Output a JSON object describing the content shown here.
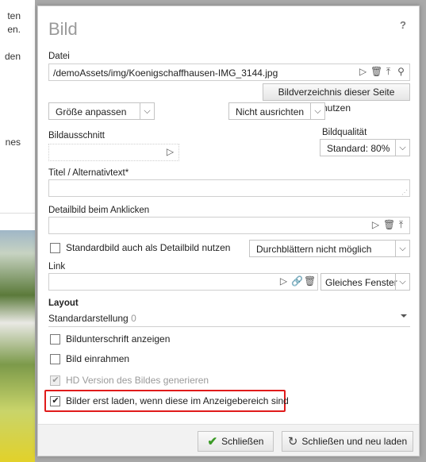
{
  "background": {
    "text_lines": [
      "ten",
      "en.",
      "den",
      "nes"
    ]
  },
  "dialog": {
    "title": "Bild",
    "help": "?",
    "datei": {
      "label": "Datei",
      "value": "/demoAssets/img/Koenigschaffhausen-IMG_3144.jpg",
      "button": "Bildverzeichnis dieser Seite nutzen"
    },
    "groesse": {
      "value": "Größe anpassen"
    },
    "ausrichten": {
      "value": "Nicht ausrichten"
    },
    "bildausschnitt": {
      "label": "Bildausschnitt"
    },
    "bildqualitaet": {
      "label": "Bildqualität",
      "value": "Standard: 80%"
    },
    "titel": {
      "label": "Titel / Alternativtext*",
      "value": ""
    },
    "detailbild": {
      "label": "Detailbild beim Anklicken",
      "value": ""
    },
    "standardbild": {
      "label": "Standardbild auch als Detailbild nutzen",
      "checked": false
    },
    "durchblaettern": {
      "value": "Durchblättern nicht möglich"
    },
    "link": {
      "label": "Link",
      "value": "",
      "target": "Gleiches Fenster"
    },
    "layout": {
      "label": "Layout",
      "value": "Standardarstellung",
      "count": "0"
    },
    "checkboxes": [
      {
        "label": "Bildunterschrift anzeigen",
        "checked": false
      },
      {
        "label": "Bild einrahmen",
        "checked": false
      },
      {
        "label": "HD Version des Bildes generieren",
        "checked": true,
        "disabled": true
      },
      {
        "label": "Bilder erst laden, wenn diese im Anzeigebereich sind",
        "checked": true
      }
    ],
    "buttons": {
      "close": "Schließen",
      "close_reload": "Schließen und neu laden"
    },
    "colors": {
      "highlight": "#e01b1b",
      "accent_green": "#3a9a25"
    }
  }
}
